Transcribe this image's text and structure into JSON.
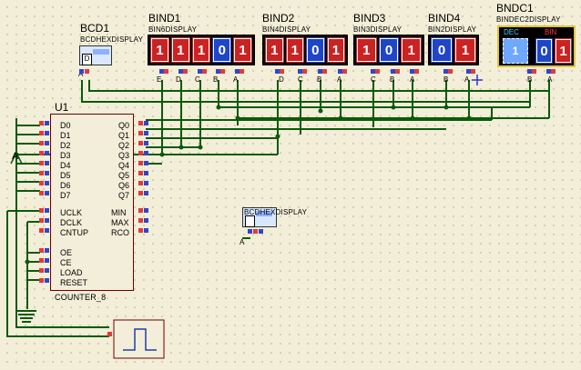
{
  "components": {
    "bcd1": {
      "ref": "BCD1",
      "type": "BCDHEXDISPLAY",
      "value": "D",
      "pin": "A"
    },
    "bind1": {
      "ref": "BIND1",
      "type": "BIN6DISPLAY",
      "digits": [
        "1",
        "1",
        "1",
        "0",
        "1"
      ],
      "pins": [
        "E",
        "D",
        "C",
        "B",
        "A"
      ]
    },
    "bind2": {
      "ref": "BIND2",
      "type": "BIN4DISPLAY",
      "digits": [
        "1",
        "1",
        "0",
        "1"
      ],
      "pins": [
        "D",
        "C",
        "B",
        "A"
      ]
    },
    "bind3": {
      "ref": "BIND3",
      "type": "BIN3DISPLAY",
      "digits": [
        "1",
        "0",
        "1"
      ],
      "pins": [
        "C",
        "B",
        "A"
      ]
    },
    "bind4": {
      "ref": "BIND4",
      "type": "BIN2DISPLAY",
      "digits": [
        "0",
        "1"
      ],
      "pins": [
        "B",
        "A"
      ]
    },
    "bindc1": {
      "ref": "BNDC1",
      "type": "BINDEC2DISPLAY",
      "dec_label": "DEC",
      "bin_label": "BIN",
      "dec_value": "1",
      "digits": [
        "0",
        "1"
      ],
      "pins": [
        "B",
        "A"
      ]
    },
    "u1": {
      "ref": "U1",
      "type": "COUNTER_8",
      "left_pins": [
        "D0",
        "D1",
        "D2",
        "D3",
        "D4",
        "D5",
        "D6",
        "D7"
      ],
      "right_pins": [
        "Q0",
        "Q1",
        "Q2",
        "Q3",
        "Q4",
        "Q5",
        "Q6",
        "Q7"
      ],
      "left_ctrl": [
        "UCLK",
        "DCLK",
        "CNTUP"
      ],
      "right_ctrl": [
        "MIN",
        "MAX",
        "RCO"
      ],
      "left_ctrl2": [
        "OE",
        "CE",
        "LOAD",
        "RESET"
      ]
    },
    "hex2": {
      "type": "BCDHEXDISPLAY",
      "pin": "A"
    },
    "power": {
      "label": "A"
    }
  },
  "colors": {
    "wire": "#0b5a0b",
    "chip_border": "#6b0000",
    "pin_red": "#e23a3a",
    "pin_blue": "#3344cc",
    "display_red": "#cc2222",
    "display_blue": "#1f45c8"
  }
}
